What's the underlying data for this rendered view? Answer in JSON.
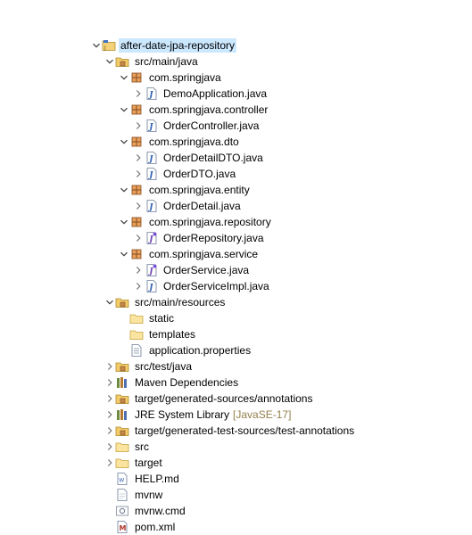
{
  "project_explorer": {
    "items": [
      {
        "label": "after-date-jpa-repository",
        "icon": "project-icon",
        "depth": 0,
        "chevron": "expanded",
        "selected": true
      },
      {
        "label": "src/main/java",
        "icon": "source-folder-icon",
        "depth": 1,
        "chevron": "expanded"
      },
      {
        "label": "com.springjava",
        "icon": "package-icon",
        "depth": 2,
        "chevron": "expanded"
      },
      {
        "label": "DemoApplication.java",
        "icon": "java-file-icon",
        "depth": 3,
        "chevron": "collapsed"
      },
      {
        "label": "com.springjava.controller",
        "icon": "package-icon",
        "depth": 2,
        "chevron": "expanded"
      },
      {
        "label": "OrderController.java",
        "icon": "java-file-icon",
        "depth": 3,
        "chevron": "collapsed"
      },
      {
        "label": "com.springjava.dto",
        "icon": "package-icon",
        "depth": 2,
        "chevron": "expanded"
      },
      {
        "label": "OrderDetailDTO.java",
        "icon": "java-file-icon",
        "depth": 3,
        "chevron": "collapsed"
      },
      {
        "label": "OrderDTO.java",
        "icon": "java-file-icon",
        "depth": 3,
        "chevron": "collapsed"
      },
      {
        "label": "com.springjava.entity",
        "icon": "package-icon",
        "depth": 2,
        "chevron": "expanded"
      },
      {
        "label": "OrderDetail.java",
        "icon": "java-file-icon",
        "depth": 3,
        "chevron": "collapsed"
      },
      {
        "label": "com.springjava.repository",
        "icon": "package-icon",
        "depth": 2,
        "chevron": "expanded"
      },
      {
        "label": "OrderRepository.java",
        "icon": "java-interface-file-icon",
        "depth": 3,
        "chevron": "collapsed"
      },
      {
        "label": "com.springjava.service",
        "icon": "package-icon",
        "depth": 2,
        "chevron": "expanded"
      },
      {
        "label": "OrderService.java",
        "icon": "java-interface-file-icon",
        "depth": 3,
        "chevron": "collapsed"
      },
      {
        "label": "OrderServiceImpl.java",
        "icon": "java-file-icon",
        "depth": 3,
        "chevron": "collapsed"
      },
      {
        "label": "src/main/resources",
        "icon": "source-folder-icon",
        "depth": 1,
        "chevron": "expanded"
      },
      {
        "label": "static",
        "icon": "folder-icon",
        "depth": 2,
        "chevron": "none"
      },
      {
        "label": "templates",
        "icon": "folder-icon",
        "depth": 2,
        "chevron": "none"
      },
      {
        "label": "application.properties",
        "icon": "properties-file-icon",
        "depth": 2,
        "chevron": "none"
      },
      {
        "label": "src/test/java",
        "icon": "source-folder-icon",
        "depth": 1,
        "chevron": "collapsed"
      },
      {
        "label": "Maven Dependencies",
        "icon": "library-icon",
        "depth": 1,
        "chevron": "collapsed"
      },
      {
        "label": "target/generated-sources/annotations",
        "icon": "source-folder-icon",
        "depth": 1,
        "chevron": "collapsed"
      },
      {
        "label": "JRE System Library",
        "decoration": "[JavaSE-17]",
        "icon": "library-icon",
        "depth": 1,
        "chevron": "collapsed"
      },
      {
        "label": "target/generated-test-sources/test-annotations",
        "icon": "source-folder-icon",
        "depth": 1,
        "chevron": "collapsed"
      },
      {
        "label": "src",
        "icon": "folder-icon",
        "depth": 1,
        "chevron": "collapsed"
      },
      {
        "label": "target",
        "icon": "folder-icon",
        "depth": 1,
        "chevron": "collapsed"
      },
      {
        "label": "HELP.md",
        "icon": "markdown-file-icon",
        "depth": 1,
        "chevron": "none"
      },
      {
        "label": "mvnw",
        "icon": "text-file-icon",
        "depth": 1,
        "chevron": "none"
      },
      {
        "label": "mvnw.cmd",
        "icon": "cmd-file-icon",
        "depth": 1,
        "chevron": "none"
      },
      {
        "label": "pom.xml",
        "icon": "maven-pom-icon",
        "depth": 1,
        "chevron": "none"
      }
    ]
  },
  "colors": {
    "selection_bg": "#cce8ff",
    "folder": "#e8b84a",
    "package": "#b5652f",
    "java": "#2f5fb3",
    "decoration": "#95804d"
  }
}
